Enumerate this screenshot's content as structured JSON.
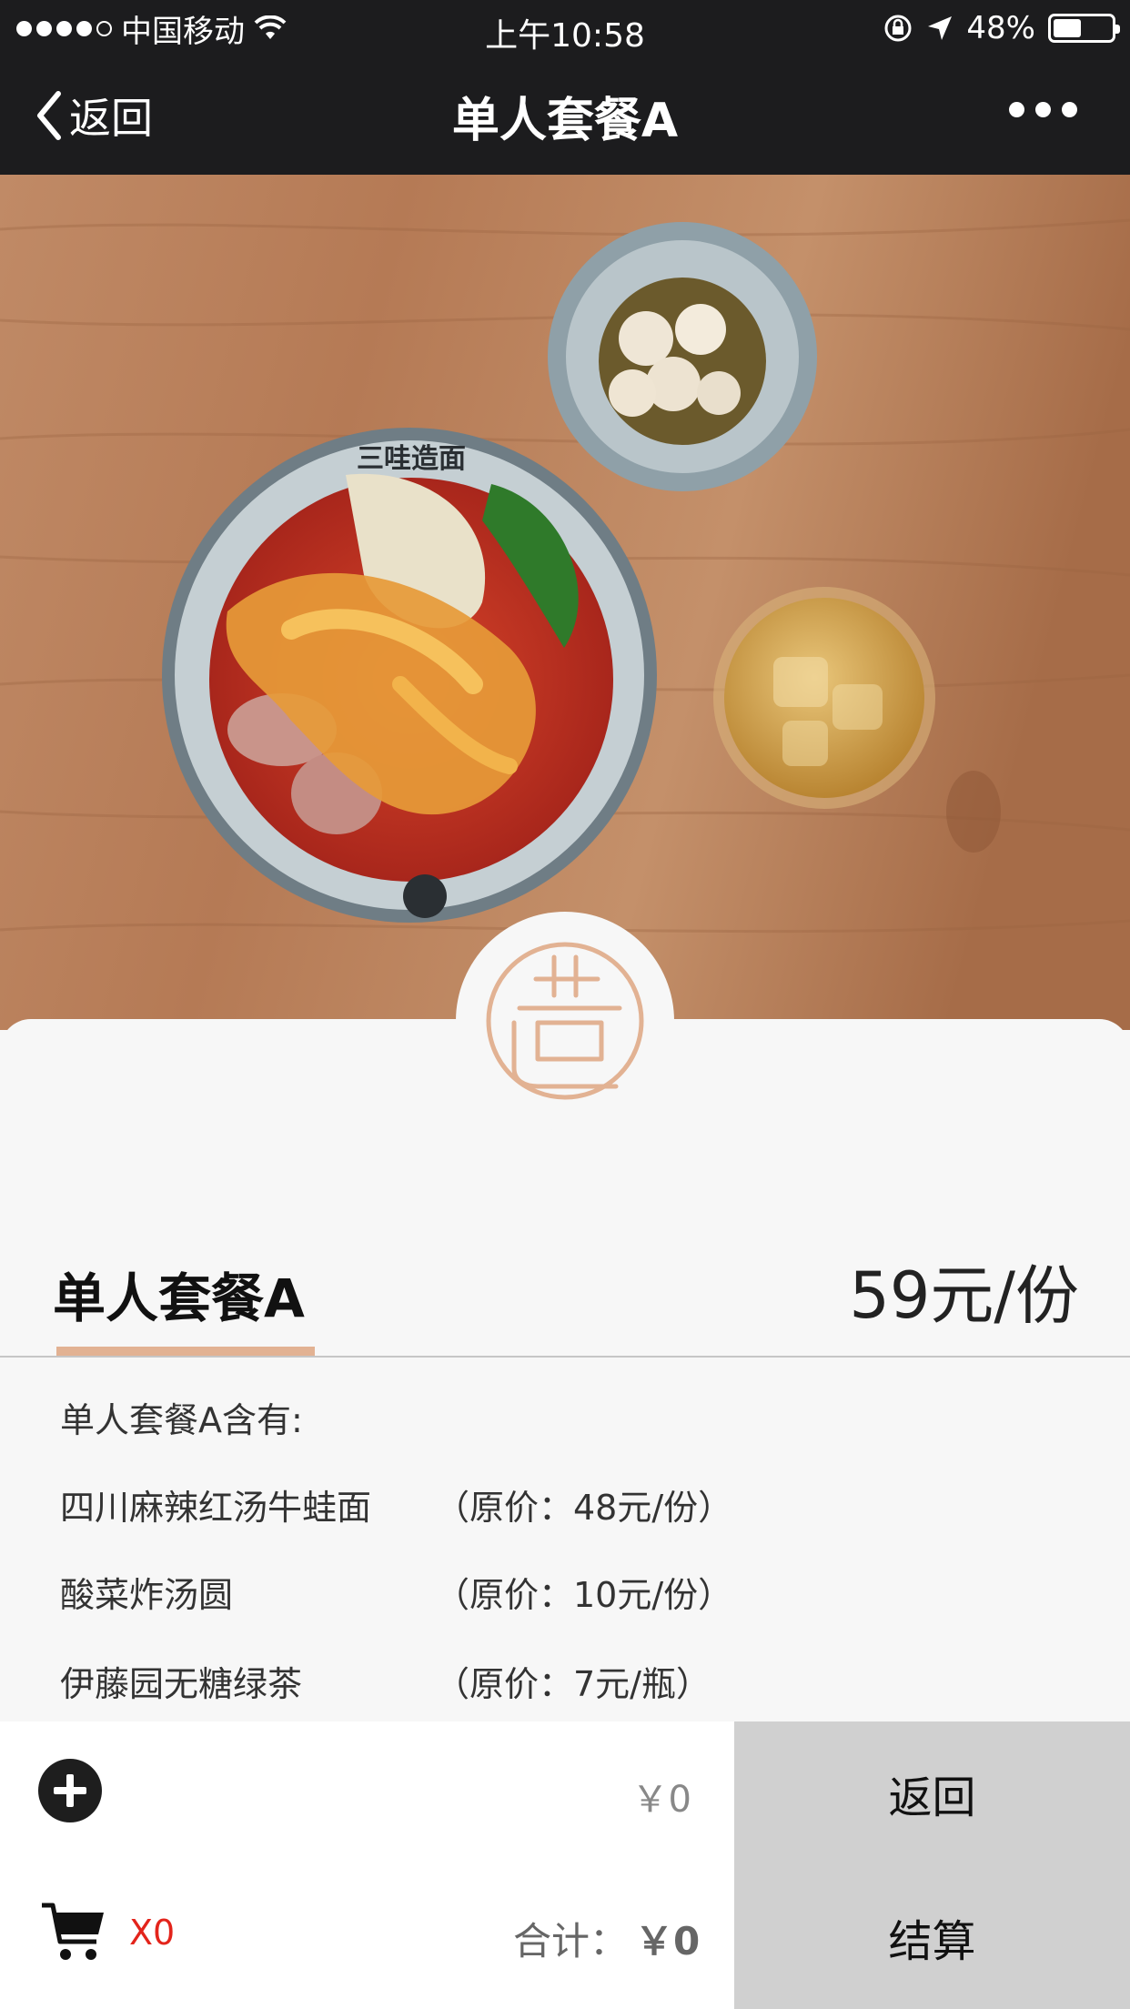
{
  "status_bar": {
    "carrier": "中国移动",
    "time": "上午10:58",
    "battery_text": "48%",
    "battery_level": 0.48,
    "icons": [
      "signal-dots-icon",
      "wifi-icon",
      "rotation-lock-icon",
      "location-arrow-icon",
      "battery-icon"
    ]
  },
  "nav": {
    "back_label": "返回",
    "title": "单人套餐A",
    "more_icon": "more-dots-icon"
  },
  "hero": {
    "bowl_text": "三哇造面"
  },
  "product": {
    "name": "单人套餐A",
    "price": "59元/份",
    "intro": "单人套餐A含有:",
    "items": [
      {
        "name": "四川麻辣红汤牛蛙面",
        "original_price": "（原价：48元/份）"
      },
      {
        "name": "酸菜炸汤圆",
        "original_price": "（原价：10元/份）"
      },
      {
        "name": "伊藤园无糖绿茶",
        "original_price": "（原价：7元/瓶）"
      }
    ]
  },
  "bottom_bar": {
    "item_price": "￥0",
    "cart_count": "X0",
    "total_label": "合计：",
    "total_amount": "￥0",
    "back_button": "返回",
    "checkout_button": "结算"
  },
  "colors": {
    "accent": "#e2b293",
    "cart_count": "#e3241b",
    "nav_background": "#1c1c1e",
    "side_button": "#d0d0d0"
  }
}
